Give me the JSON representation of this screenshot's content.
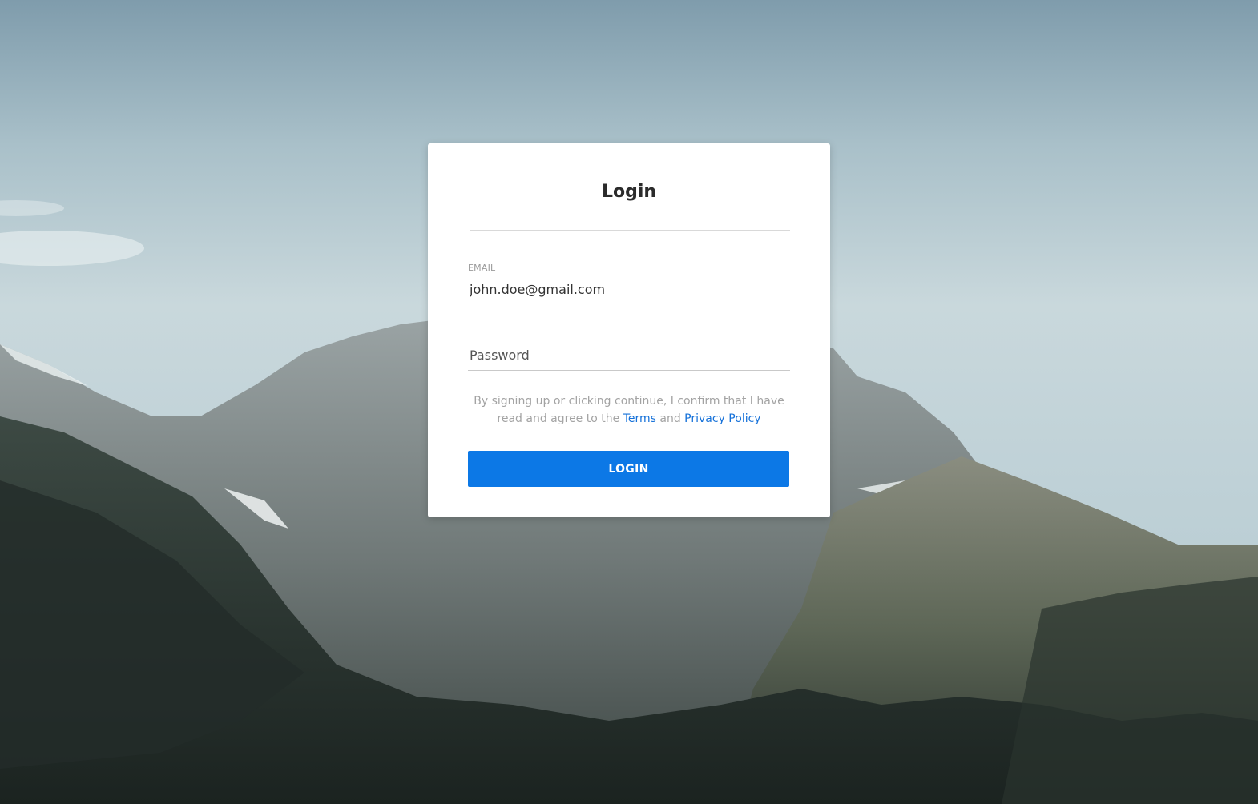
{
  "card": {
    "title": "Login"
  },
  "email": {
    "label": "EMAIL",
    "value": "john.doe@gmail.com"
  },
  "password": {
    "placeholder": "Password",
    "value": ""
  },
  "consent": {
    "text_before": "By signing up or clicking continue, I confirm that I have read and agree to the",
    "terms_link": "Terms",
    "connector": "and",
    "privacy_link": "Privacy Policy"
  },
  "login_button": {
    "label": "LOGIN"
  },
  "colors": {
    "accent": "#0c78e6",
    "link": "#1571d9",
    "card_background": "#ffffff"
  }
}
